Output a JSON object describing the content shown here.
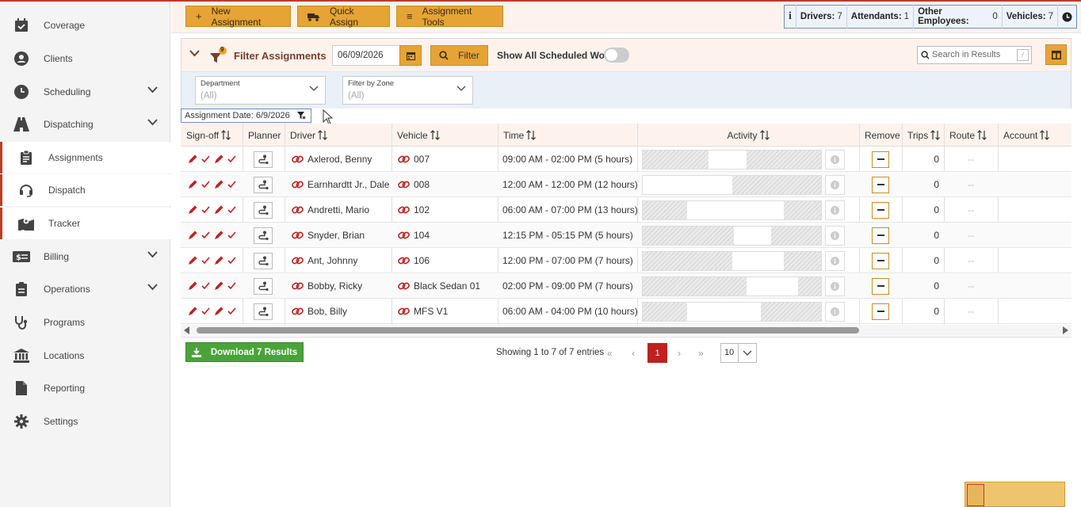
{
  "sidebar": {
    "items": [
      {
        "label": "Coverage",
        "icon": "calendar-check-icon"
      },
      {
        "label": "Clients",
        "icon": "user-circle-icon"
      },
      {
        "label": "Scheduling",
        "icon": "clock-icon",
        "expand": true
      },
      {
        "label": "Dispatching",
        "icon": "road-icon",
        "expand": true
      },
      {
        "label": "Assignments",
        "icon": "clipboard-icon",
        "sub": true
      },
      {
        "label": "Dispatch",
        "icon": "headset-icon",
        "sub": true
      },
      {
        "label": "Tracker",
        "icon": "map-marker-icon",
        "sub": true
      },
      {
        "label": "Billing",
        "icon": "money-icon",
        "expand": true
      },
      {
        "label": "Operations",
        "icon": "clipboard-list-icon",
        "expand": true
      },
      {
        "label": "Programs",
        "icon": "stethoscope-icon"
      },
      {
        "label": "Locations",
        "icon": "building-columns-icon"
      },
      {
        "label": "Reporting",
        "icon": "file-icon"
      },
      {
        "label": "Settings",
        "icon": "gear-icon"
      }
    ]
  },
  "toolbar": {
    "new_assignment": "New Assignment",
    "quick_assign": "Quick Assign",
    "assignment_tools": "Assignment Tools",
    "counts": [
      {
        "label": "Drivers:",
        "value": "7"
      },
      {
        "label": "Attendants:",
        "value": "1"
      },
      {
        "label": "Other Employees:",
        "value": "0"
      },
      {
        "label": "Vehicles:",
        "value": "7"
      }
    ]
  },
  "filter": {
    "badge": "9",
    "title": "Filter Assignments",
    "date": "06/09/2026",
    "filter_button": "Filter",
    "show_all_label": "Show All Scheduled Work",
    "search_placeholder": "Search in Results",
    "department_label": "Department",
    "department_value": "(All)",
    "zone_label": "Filter by Zone",
    "zone_value": "(All)",
    "chip": "Assignment Date: 6/9/2026"
  },
  "table": {
    "headers": [
      "Sign-off",
      "Planner",
      "Driver",
      "Vehicle",
      "Time",
      "Activity",
      "Remove",
      "Trips",
      "Route",
      "Account"
    ],
    "rows": [
      {
        "driver": "Axlerod, Benny",
        "vehicle": "007",
        "time": "09:00 AM - 02:00 PM (5 hours)",
        "trips": "0",
        "route": "--",
        "act": [
          [
            0,
            0.37
          ],
          [
            0.58,
            1.0
          ]
        ]
      },
      {
        "driver": "Earnhardtt Jr., Dale",
        "vehicle": "008",
        "time": "12:00 AM - 12:00 PM (12 hours)",
        "trips": "0",
        "route": "--",
        "act": [
          [
            0.5,
            1.0
          ]
        ]
      },
      {
        "driver": "Andretti, Mario",
        "vehicle": "102",
        "time": "06:00 AM - 07:00 PM (13 hours)",
        "trips": "0",
        "route": "--",
        "act": [
          [
            0,
            0.25
          ],
          [
            0.79,
            1.0
          ]
        ]
      },
      {
        "driver": "Snyder, Brian",
        "vehicle": "104",
        "time": "12:15 PM - 05:15 PM (5 hours)",
        "trips": "0",
        "route": "--",
        "act": [
          [
            0,
            0.51
          ],
          [
            0.72,
            1.0
          ]
        ]
      },
      {
        "driver": "Ant, Johnny",
        "vehicle": "106",
        "time": "12:00 PM - 07:00 PM (7 hours)",
        "trips": "0",
        "route": "--",
        "act": [
          [
            0,
            0.5
          ],
          [
            0.79,
            1.0
          ]
        ]
      },
      {
        "driver": "Bobby, Ricky",
        "vehicle": "Black Sedan 01",
        "time": "02:00 PM - 09:00 PM (7 hours)",
        "trips": "0",
        "route": "--",
        "act": [
          [
            0,
            0.58
          ],
          [
            0.87,
            1.0
          ]
        ]
      },
      {
        "driver": "Bob, Billy",
        "vehicle": "MFS V1",
        "time": "06:00 AM - 04:00 PM (10 hours)",
        "trips": "0",
        "route": "--",
        "act": [
          [
            0,
            0.25
          ],
          [
            0.66,
            1.0
          ]
        ]
      }
    ]
  },
  "footer": {
    "download": "Download 7 Results",
    "showing": "Showing 1 to 7 of 7 entries",
    "page": "1",
    "page_size": "10"
  },
  "colors": {
    "accent": "#e5a435",
    "brand_red": "#c0201e",
    "download_green": "#4aa33a"
  }
}
